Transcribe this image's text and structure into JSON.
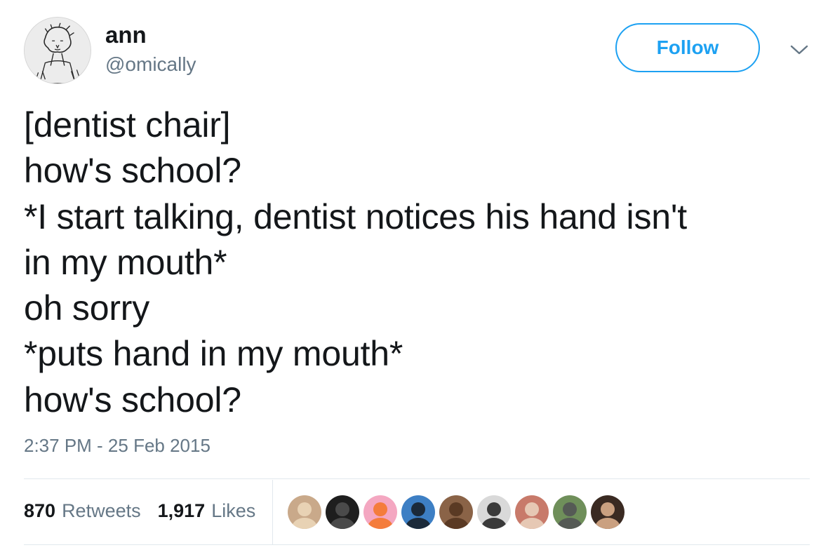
{
  "user": {
    "display_name": "ann",
    "handle": "@omically",
    "avatar_icon": "sketch-portrait-avatar"
  },
  "follow_label": "Follow",
  "caret_icon": "chevron-down-icon",
  "tweet": {
    "lines": [
      "[dentist chair]",
      "how's school?",
      "*I start talking, dentist notices his hand isn't",
      "in my mouth*",
      "oh sorry",
      "*puts hand in my mouth*",
      "how's school?"
    ],
    "timestamp": "2:37 PM - 25 Feb 2015"
  },
  "stats": {
    "retweets_count": "870",
    "retweets_label": "Retweets",
    "likes_count": "1,917",
    "likes_label": "Likes"
  },
  "likers": [
    {
      "name": "liker-avatar-1",
      "bg": "#c9a98a",
      "fg": "#e8d2b4"
    },
    {
      "name": "liker-avatar-2",
      "bg": "#1e1e1e",
      "fg": "#4a4a4a"
    },
    {
      "name": "liker-avatar-3",
      "bg": "#f4a7c1",
      "fg": "#f47c3c"
    },
    {
      "name": "liker-avatar-4",
      "bg": "#3d7fc4",
      "fg": "#1b2a3a"
    },
    {
      "name": "liker-avatar-5",
      "bg": "#8a6347",
      "fg": "#5a3a24"
    },
    {
      "name": "liker-avatar-6",
      "bg": "#d9d9d9",
      "fg": "#3a3a3a"
    },
    {
      "name": "liker-avatar-7",
      "bg": "#c87a6a",
      "fg": "#e6c8b4"
    },
    {
      "name": "liker-avatar-8",
      "bg": "#6f8f5a",
      "fg": "#555a55"
    },
    {
      "name": "liker-avatar-9",
      "bg": "#3a2a22",
      "fg": "#caa080"
    }
  ],
  "colors": {
    "accent": "#1da1f2",
    "text": "#14171a",
    "secondary": "#657786",
    "divider": "#e1e8ed"
  }
}
